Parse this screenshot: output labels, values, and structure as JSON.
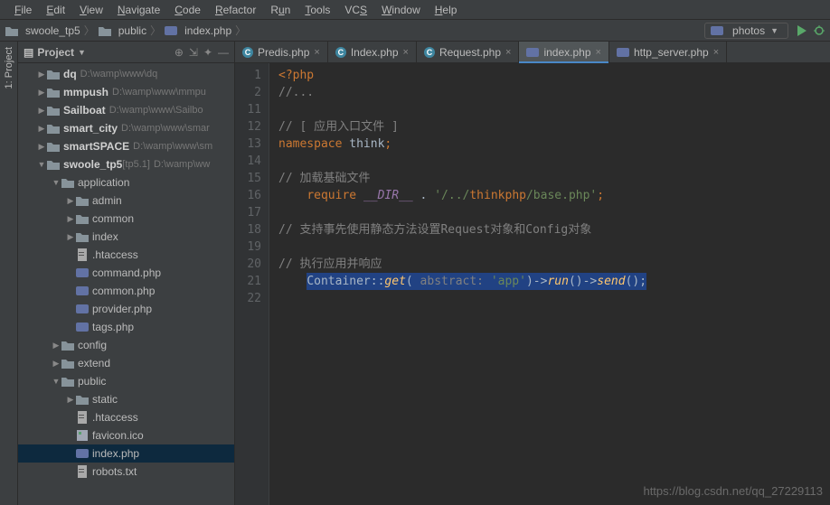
{
  "menubar": [
    "File",
    "Edit",
    "View",
    "Navigate",
    "Code",
    "Refactor",
    "Run",
    "Tools",
    "VCS",
    "Window",
    "Help"
  ],
  "breadcrumbs": [
    {
      "icon": "folder",
      "label": "swoole_tp5"
    },
    {
      "icon": "folder",
      "label": "public"
    },
    {
      "icon": "php",
      "label": "index.php"
    }
  ],
  "run_config": {
    "label": "photos"
  },
  "side_tab": "1: Project",
  "project_panel": {
    "title": "Project",
    "tree": [
      {
        "depth": 0,
        "arrow": "right",
        "icon": "dir",
        "label": "dq",
        "bold": true,
        "path": "D:\\wamp\\www\\dq"
      },
      {
        "depth": 0,
        "arrow": "right",
        "icon": "dir",
        "label": "mmpush",
        "bold": true,
        "path": "D:\\wamp\\www\\mmpu"
      },
      {
        "depth": 0,
        "arrow": "right",
        "icon": "dir",
        "label": "Sailboat",
        "bold": true,
        "path": "D:\\wamp\\www\\Sailbo"
      },
      {
        "depth": 0,
        "arrow": "right",
        "icon": "dir",
        "label": "smart_city",
        "bold": true,
        "path": "D:\\wamp\\www\\smar"
      },
      {
        "depth": 0,
        "arrow": "right",
        "icon": "dir",
        "label": "smartSPACE",
        "bold": true,
        "path": "D:\\wamp\\www\\sm"
      },
      {
        "depth": 0,
        "arrow": "down",
        "icon": "dir",
        "label": "swoole_tp5",
        "bold": true,
        "branch": "[tp5.1]",
        "path": "D:\\wamp\\ww"
      },
      {
        "depth": 1,
        "arrow": "down",
        "icon": "dir",
        "label": "application"
      },
      {
        "depth": 2,
        "arrow": "right",
        "icon": "dir",
        "label": "admin"
      },
      {
        "depth": 2,
        "arrow": "right",
        "icon": "dir",
        "label": "common"
      },
      {
        "depth": 2,
        "arrow": "right",
        "icon": "dir",
        "label": "index"
      },
      {
        "depth": 2,
        "arrow": "",
        "icon": "file",
        "label": ".htaccess"
      },
      {
        "depth": 2,
        "arrow": "",
        "icon": "php",
        "label": "command.php"
      },
      {
        "depth": 2,
        "arrow": "",
        "icon": "php",
        "label": "common.php"
      },
      {
        "depth": 2,
        "arrow": "",
        "icon": "php",
        "label": "provider.php"
      },
      {
        "depth": 2,
        "arrow": "",
        "icon": "php",
        "label": "tags.php"
      },
      {
        "depth": 1,
        "arrow": "right",
        "icon": "dir",
        "label": "config"
      },
      {
        "depth": 1,
        "arrow": "right",
        "icon": "dir",
        "label": "extend"
      },
      {
        "depth": 1,
        "arrow": "down",
        "icon": "dir",
        "label": "public"
      },
      {
        "depth": 2,
        "arrow": "right",
        "icon": "dir",
        "label": "static"
      },
      {
        "depth": 2,
        "arrow": "",
        "icon": "file",
        "label": ".htaccess"
      },
      {
        "depth": 2,
        "arrow": "",
        "icon": "ico",
        "label": "favicon.ico"
      },
      {
        "depth": 2,
        "arrow": "",
        "icon": "php",
        "label": "index.php",
        "selected": true
      },
      {
        "depth": 2,
        "arrow": "",
        "icon": "file",
        "label": "robots.txt"
      }
    ]
  },
  "tabs": [
    {
      "icon": "c",
      "label": "Predis.php"
    },
    {
      "icon": "c",
      "label": "Index.php"
    },
    {
      "icon": "c",
      "label": "Request.php"
    },
    {
      "icon": "php",
      "label": "index.php",
      "active": true
    },
    {
      "icon": "php",
      "label": "http_server.php"
    }
  ],
  "gutter_lines": [
    "1",
    "2",
    "11",
    "12",
    "13",
    "14",
    "15",
    "16",
    "17",
    "18",
    "19",
    "20",
    "21",
    "22"
  ],
  "code": {
    "l1_open": "<?php",
    "l2": "//...",
    "l12": "// [ 应用入口文件 ]",
    "l13_kw": "namespace ",
    "l13_ns": "think",
    "l15": "// 加载基础文件",
    "l16_kw": "require ",
    "l16_const": "__DIR__",
    "l16_dot": " . ",
    "l16_s1": "'/../",
    "l16_s2": "thinkphp",
    "l16_s3": "/base.php'",
    "l18": "// 支持事先使用静态方法设置Request对象和Config对象",
    "l20": "// 执行应用并响应",
    "l21_class": "Container",
    "l21_sep": "::",
    "l21_get": "get",
    "l21_hint": " abstract: ",
    "l21_app": "'app'",
    "l21_run": "run",
    "l21_send": "send"
  },
  "watermark": "https://blog.csdn.net/qq_27229113"
}
